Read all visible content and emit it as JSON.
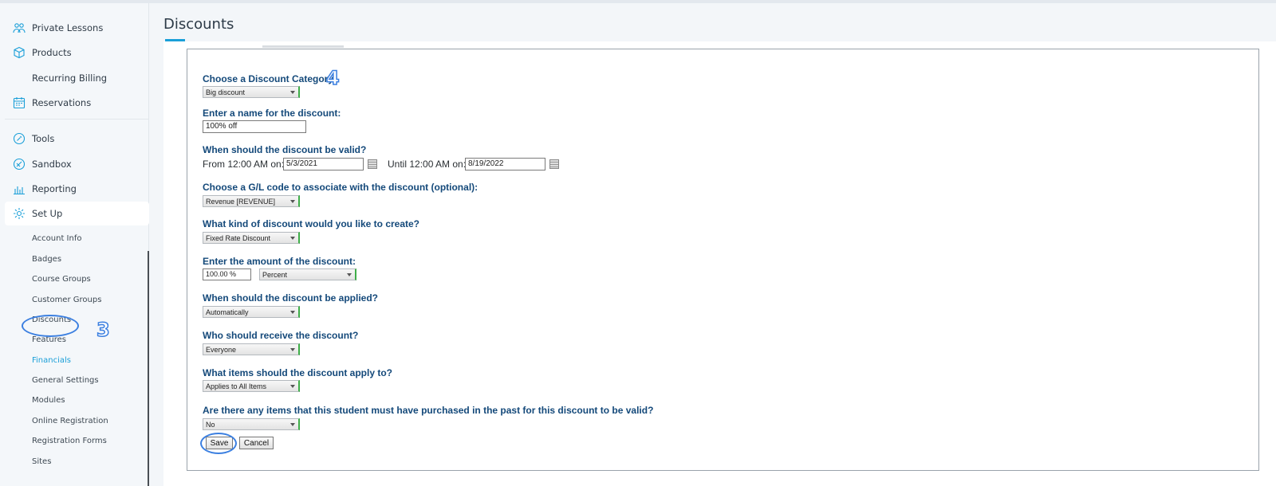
{
  "sidebar": {
    "items": [
      {
        "label": "Private Lessons",
        "icon": "people-icon"
      },
      {
        "label": "Products",
        "icon": "box-icon"
      },
      {
        "label": "Recurring Billing",
        "icon": ""
      },
      {
        "label": "Reservations",
        "icon": "calendar-icon"
      },
      {
        "label": "Tools",
        "icon": "tools-icon"
      },
      {
        "label": "Sandbox",
        "icon": "sandbox-icon"
      },
      {
        "label": "Reporting",
        "icon": "bar-chart-icon"
      },
      {
        "label": "Set Up",
        "icon": "gear-icon"
      }
    ],
    "setup_sub_items": [
      "Account Info",
      "Badges",
      "Course Groups",
      "Customer Groups",
      "Discounts",
      "Features",
      "Financials",
      "General Settings",
      "Modules",
      "Online Registration",
      "Registration Forms",
      "Sites"
    ]
  },
  "page": {
    "title": "Discounts"
  },
  "form": {
    "category_label": "Choose a Discount Category:",
    "category_value": "Big discount",
    "name_label": "Enter a name for the discount:",
    "name_value": "100% off",
    "valid_label": "When should the discount be valid?",
    "from_label": "From 12:00 AM on:",
    "from_value": "5/3/2021",
    "until_label": "Until 12:00 AM on:",
    "until_value": "8/19/2022",
    "gl_label": "Choose a G/L code to associate with the discount (optional):",
    "gl_value": "Revenue [REVENUE]",
    "kind_label": "What kind of discount would you like to create?",
    "kind_value": "Fixed Rate Discount",
    "amount_label": "Enter the amount of the discount:",
    "amount_value": "100.00 %",
    "amount_unit": "Percent",
    "applied_label": "When should the discount be applied?",
    "applied_value": "Automatically",
    "receive_label": "Who should receive the discount?",
    "receive_value": "Everyone",
    "items_label": "What items should the discount apply to?",
    "items_value": "Applies to All Items",
    "past_label": "Are there any items that this student must have purchased in the past for this discount to be valid?",
    "past_value": "No",
    "save_label": "Save",
    "cancel_label": "Cancel"
  },
  "annotations": {
    "step3": "3",
    "step4": "4"
  },
  "colors": {
    "accent": "#1a9fd8",
    "heading": "#14497a",
    "annotation": "#3b7fe0"
  }
}
